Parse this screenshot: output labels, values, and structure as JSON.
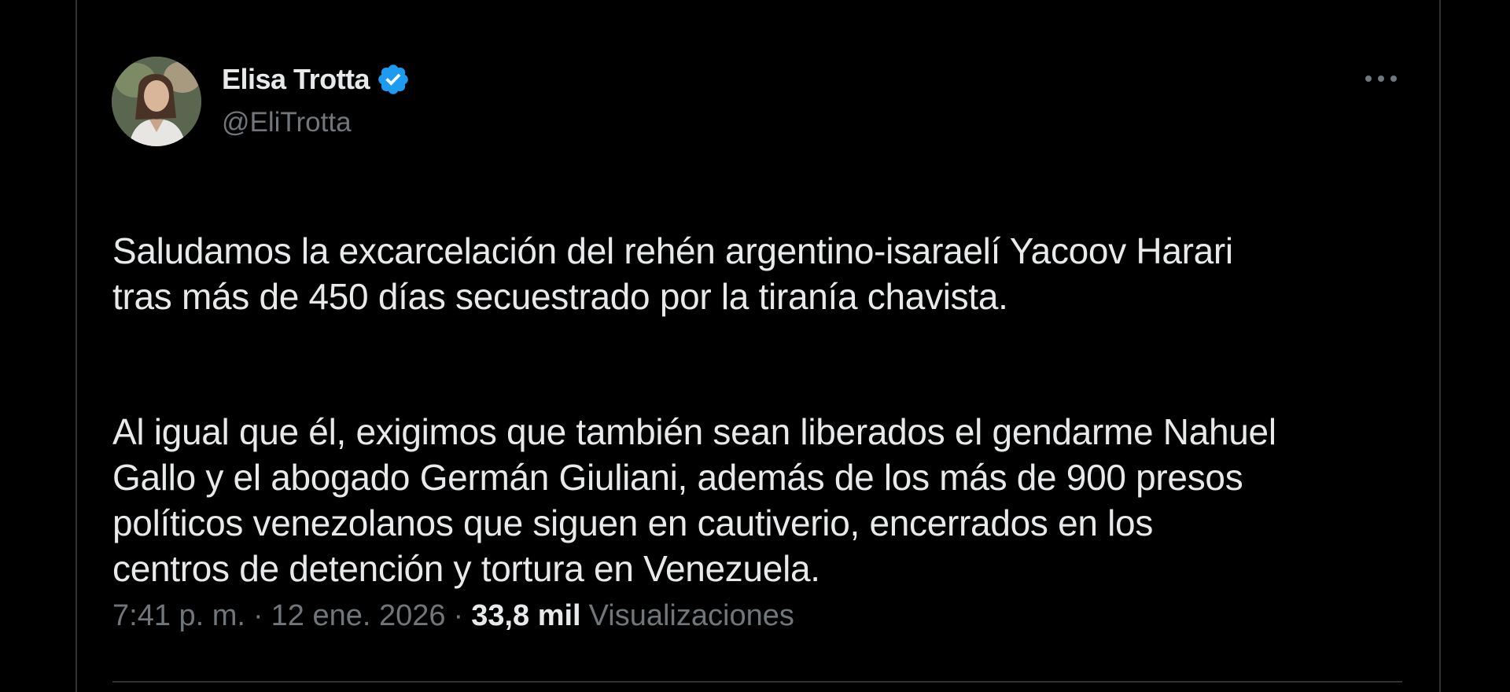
{
  "author": {
    "display_name": "Elisa Trotta",
    "handle": "@EliTrotta",
    "verified": true,
    "avatar_alt": "avatar"
  },
  "post": {
    "paragraphs": [
      "Saludamos la excarcelación del rehén argentino-isaraelí Yacoov Harari\ntras más de 450 días secuestrado por la tiranía chavista.",
      "Al igual que él, exigimos que también sean liberados el gendarme Nahuel\nGallo y el abogado Germán Giuliani, además de los más de 900 presos\npolíticos venezolanos que siguen en cautiverio, encerrados en los\ncentros de detención y tortura en Venezuela."
    ],
    "time": "7:41 p. m.",
    "separator": "·",
    "date": "12 ene. 2026",
    "views_count": "33,8 mil",
    "views_label": "Visualizaciones"
  },
  "icons": {
    "verified": "verified-badge-icon",
    "more": "more-options-icon"
  },
  "colors": {
    "background": "#000000",
    "text_primary": "#e7e9ea",
    "text_secondary": "#71767b",
    "verified_blue": "#1d9bf0",
    "border": "#2f3336"
  }
}
